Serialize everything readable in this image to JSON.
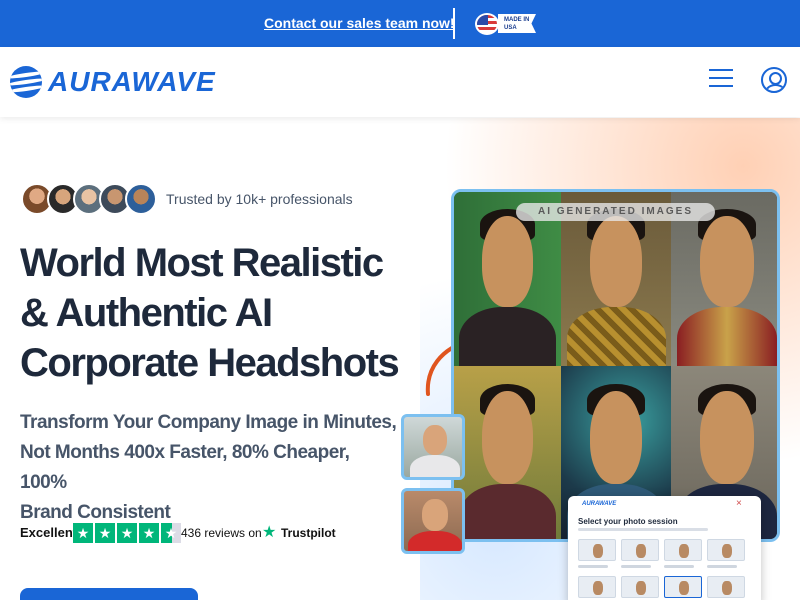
{
  "topbar": {
    "contact_link": "Contact our sales team now!",
    "badge_line1": "MADE IN",
    "badge_line2": "USA",
    "bg_color": "#1a66d6"
  },
  "header": {
    "brand": "AURAWAVE",
    "menu_icon": "hamburger-menu-icon",
    "account_icon": "user-account-icon",
    "brand_color": "#1a66d6"
  },
  "hero": {
    "trusted_text": "Trusted by 10k+ professionals",
    "headline": [
      "World Most Realistic",
      "& Authentic AI",
      "Corporate Headshots"
    ],
    "subline": [
      "Transform Your Company Image in Minutes,",
      "Not Months 400x Faster,  80% Cheaper, 100%",
      "Brand Consistent"
    ]
  },
  "trustpilot": {
    "rating_word": "Excellent",
    "stars": 4.5,
    "reviews_count": "436",
    "reviews_suffix": " reviews on",
    "brand": "Trustpilot",
    "star_glyph": "★",
    "color": "#00b67a"
  },
  "showcase": {
    "label": "AI GENERATED IMAGES",
    "session_panel": {
      "brand": "AURAWAVE",
      "title": "Select your photo session",
      "close_glyph": "×"
    }
  }
}
